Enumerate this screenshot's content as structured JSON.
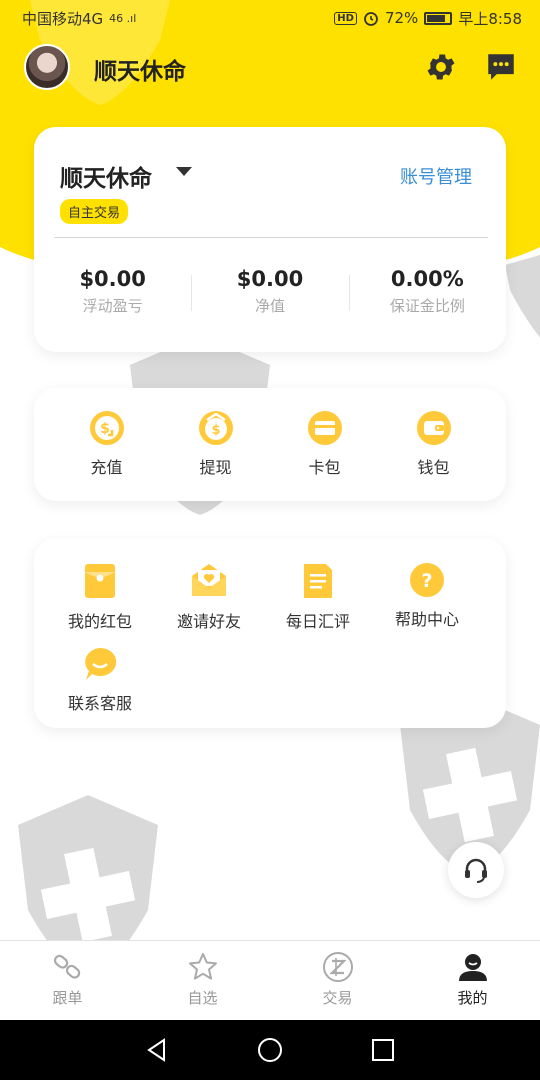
{
  "status_bar": {
    "carrier": "中国移动4G",
    "signal": "46 .ıl",
    "hd_badge": "HD",
    "battery": "72%",
    "battery_level": 0.72,
    "time": "早上8:58"
  },
  "header": {
    "username": "顺天休命"
  },
  "account": {
    "name": "顺天休命",
    "manage_link": "账号管理",
    "tag": "自主交易",
    "stats": [
      {
        "value": "$0.00",
        "label": "浮动盈亏"
      },
      {
        "value": "$0.00",
        "label": "净值"
      },
      {
        "value": "0.00%",
        "label": "保证金比例"
      }
    ]
  },
  "wallet": {
    "items": [
      {
        "label": "充值",
        "icon": "recharge-icon"
      },
      {
        "label": "提现",
        "icon": "withdraw-icon"
      },
      {
        "label": "卡包",
        "icon": "card-icon"
      },
      {
        "label": "钱包",
        "icon": "wallet-icon"
      }
    ]
  },
  "services": {
    "items": [
      {
        "label": "我的红包",
        "icon": "red-packet-icon"
      },
      {
        "label": "邀请好友",
        "icon": "invite-icon"
      },
      {
        "label": "每日汇评",
        "icon": "document-icon"
      },
      {
        "label": "帮助中心",
        "icon": "help-icon"
      },
      {
        "label": "联系客服",
        "icon": "chat-bubble-icon"
      }
    ]
  },
  "bottom_nav": {
    "items": [
      {
        "label": "跟单",
        "icon": "link-icon",
        "active": false
      },
      {
        "label": "自选",
        "icon": "star-icon",
        "active": false
      },
      {
        "label": "交易",
        "icon": "trade-icon",
        "active": false
      },
      {
        "label": "我的",
        "icon": "user-icon",
        "active": true
      }
    ]
  },
  "colors": {
    "brand_yellow": "#ffe100",
    "icon_yellow": "#ffc93a",
    "link_blue": "#3a8ed6"
  }
}
